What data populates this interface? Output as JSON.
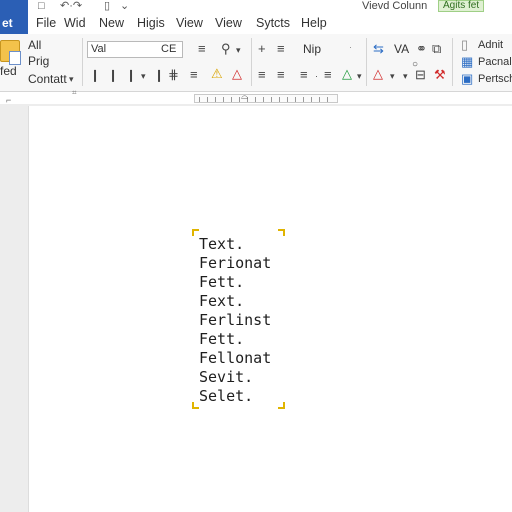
{
  "titlebar": {
    "quick_access": [
      "□",
      "↶·↷",
      "▯",
      "⌄"
    ],
    "window_title": "Vievd Colunn",
    "badge": "Agits fet"
  },
  "menu": {
    "active_tab": "et",
    "items": [
      "File",
      "Wid",
      "New",
      "Higis",
      "View",
      "View",
      "Sytcts",
      "Help"
    ]
  },
  "ribbon": {
    "clipboard": {
      "paste_label": "fed",
      "all_label": "All",
      "prig_label": "Prig",
      "contact_label": "Contatt"
    },
    "font": {
      "font_name": "Val",
      "font_size": "CE",
      "dropdown_caret": "⌄"
    },
    "paragraph": {
      "nip_label": "Nip",
      "va_label": "VA"
    },
    "styles": {
      "item_1": "Adnit",
      "item_2": "Pacnal",
      "item_3": "Pertsch"
    },
    "colors": {
      "warn": "#d9a400",
      "error": "#d12b2b",
      "ok": "#1e9a3b",
      "accent": "#2b5fb5"
    }
  },
  "document": {
    "lines": [
      "Text.",
      "Ferionat",
      "Fett.",
      "Fext.",
      "Ferlinst",
      "Fett.",
      "Fellonat",
      "Sevit.",
      "Selet."
    ]
  }
}
